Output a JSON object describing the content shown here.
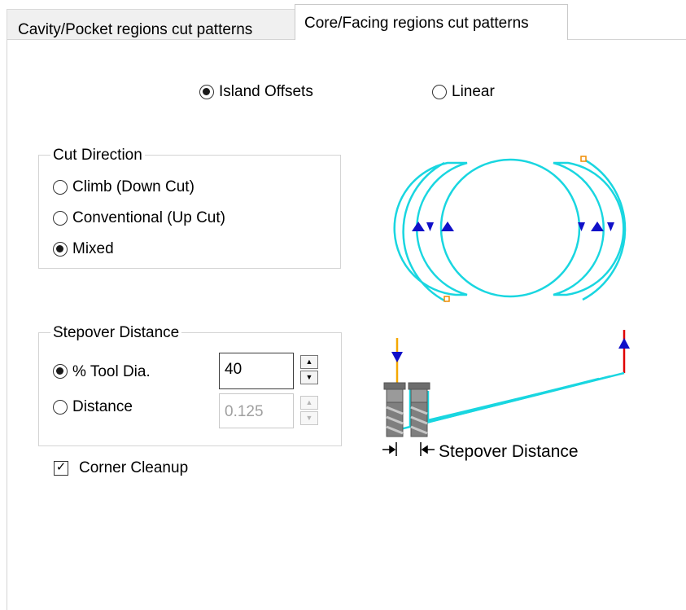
{
  "tabs": {
    "inactive_label": "Cavity/Pocket regions cut patterns",
    "active_label": "Core/Facing regions cut patterns"
  },
  "pattern": {
    "island_offsets_label": "Island Offsets",
    "island_offsets_selected": true,
    "linear_label": "Linear",
    "linear_selected": false
  },
  "cut_direction": {
    "title": "Cut Direction",
    "climb_label": "Climb (Down Cut)",
    "conventional_label": "Conventional (Up Cut)",
    "mixed_label": "Mixed",
    "selected": "Mixed"
  },
  "stepover": {
    "title": "Stepover Distance",
    "tool_dia_label": "% Tool Dia.",
    "tool_dia_value": "40",
    "tool_dia_selected": true,
    "distance_label": "Distance",
    "distance_value": "0.125",
    "distance_selected": false
  },
  "corner_cleanup": {
    "label": "Corner Cleanup",
    "checked": true,
    "check_glyph": "✓"
  },
  "diagram": {
    "stepover_label": "Stepover Distance"
  },
  "icons": {
    "spin_up": "▲",
    "spin_down": "▼"
  },
  "colors": {
    "toolpath": "#19d6e0",
    "plunge": "#f5a800",
    "retract": "#e00000",
    "arrow": "#1010c8",
    "marker": "#f08c00"
  }
}
